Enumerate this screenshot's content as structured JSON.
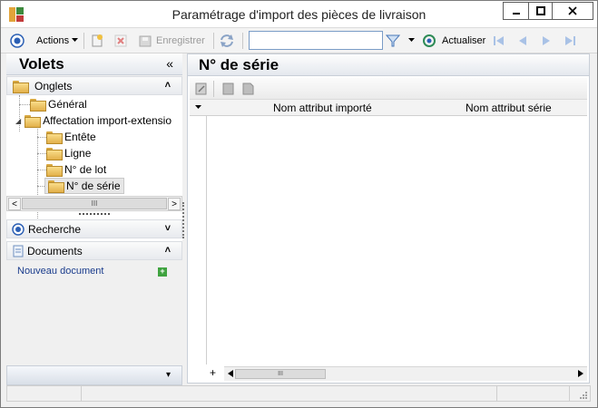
{
  "window": {
    "title": "Paramétrage d'import des pièces de livraison",
    "minimize_glyph": "—",
    "maximize_glyph": "□",
    "close_glyph": "✕"
  },
  "toolbar": {
    "actions_label": "Actions",
    "save_label": "Enregistrer",
    "search_value": "",
    "refresh_label": "Actualiser"
  },
  "left_pane": {
    "title": "Volets",
    "collapse_glyph": "«",
    "tabs_section": {
      "label": "Onglets",
      "chevron": "˄",
      "tree": [
        {
          "label": "Général",
          "level": 1
        },
        {
          "label": "Affectation import-extensio",
          "level": 1
        },
        {
          "label": "Entête",
          "level": 2
        },
        {
          "label": "Ligne",
          "level": 2
        },
        {
          "label": "N° de lot",
          "level": 2
        },
        {
          "label": "N° de série",
          "level": 2,
          "selected": true
        }
      ],
      "scroll_thumb": "III",
      "scroll_left": "<",
      "scroll_right": ">"
    },
    "search_section": {
      "label": "Recherche",
      "chevron": "˅"
    },
    "documents_section": {
      "label": "Documents",
      "chevron": "˄",
      "new_document_link": "Nouveau document",
      "add_glyph": "+"
    },
    "bottom_chevron": "▾"
  },
  "main": {
    "title": "N° de série",
    "grid": {
      "columns": [
        "Nom attribut importé",
        "Nom attribut série"
      ],
      "rows": [],
      "add_row_glyph": "+",
      "scroll_thumb": "III"
    }
  },
  "colors": {
    "accent": "#2b6cc4",
    "folder": "#e8bd57",
    "link": "#1a3c8c"
  }
}
